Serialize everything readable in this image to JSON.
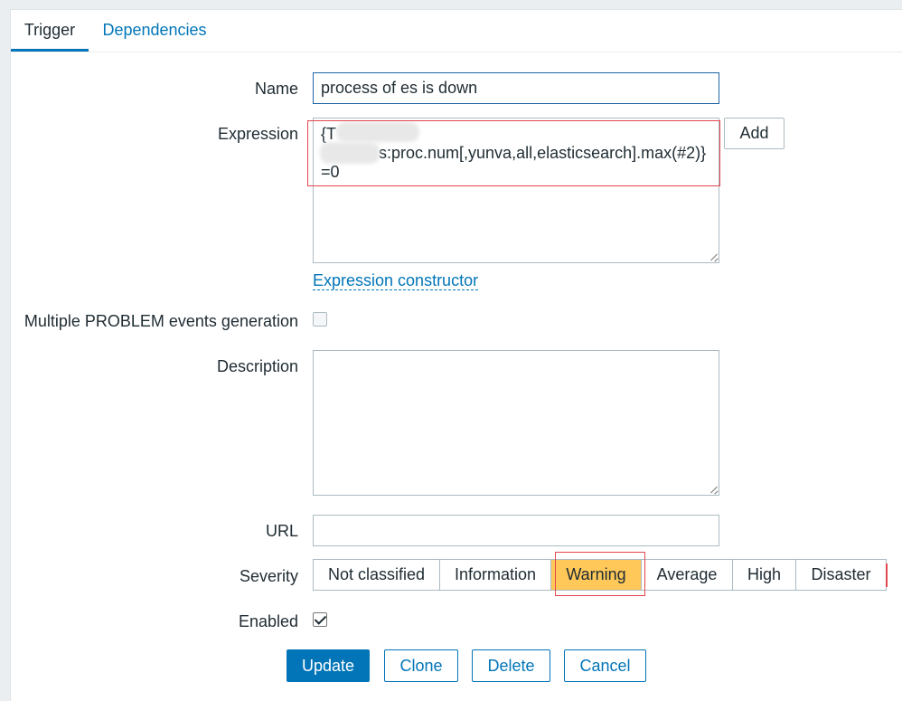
{
  "tabs": [
    {
      "label": "Trigger",
      "active": true
    },
    {
      "label": "Dependencies",
      "active": false
    }
  ],
  "form": {
    "name": {
      "label": "Name",
      "value": "process of es is down"
    },
    "expression": {
      "label": "Expression",
      "line1": "{T",
      "line2": "s:proc.num[,yunva,all,elasticsearch].max(#2)}",
      "line3": "=0",
      "add_button": "Add",
      "constructor_link": "Expression constructor"
    },
    "multiple_events": {
      "label": "Multiple PROBLEM events generation",
      "checked": false
    },
    "description": {
      "label": "Description",
      "value": ""
    },
    "url": {
      "label": "URL",
      "value": ""
    },
    "severity": {
      "label": "Severity",
      "options": [
        "Not classified",
        "Information",
        "Warning",
        "Average",
        "High",
        "Disaster"
      ],
      "selected": "Warning",
      "selected_color": "#ffc859"
    },
    "enabled": {
      "label": "Enabled",
      "checked": true
    }
  },
  "actions": {
    "update": "Update",
    "clone": "Clone",
    "delete": "Delete",
    "cancel": "Cancel"
  },
  "colors": {
    "accent": "#0275b8",
    "highlight": "#e2464d",
    "warning": "#ffc859"
  }
}
